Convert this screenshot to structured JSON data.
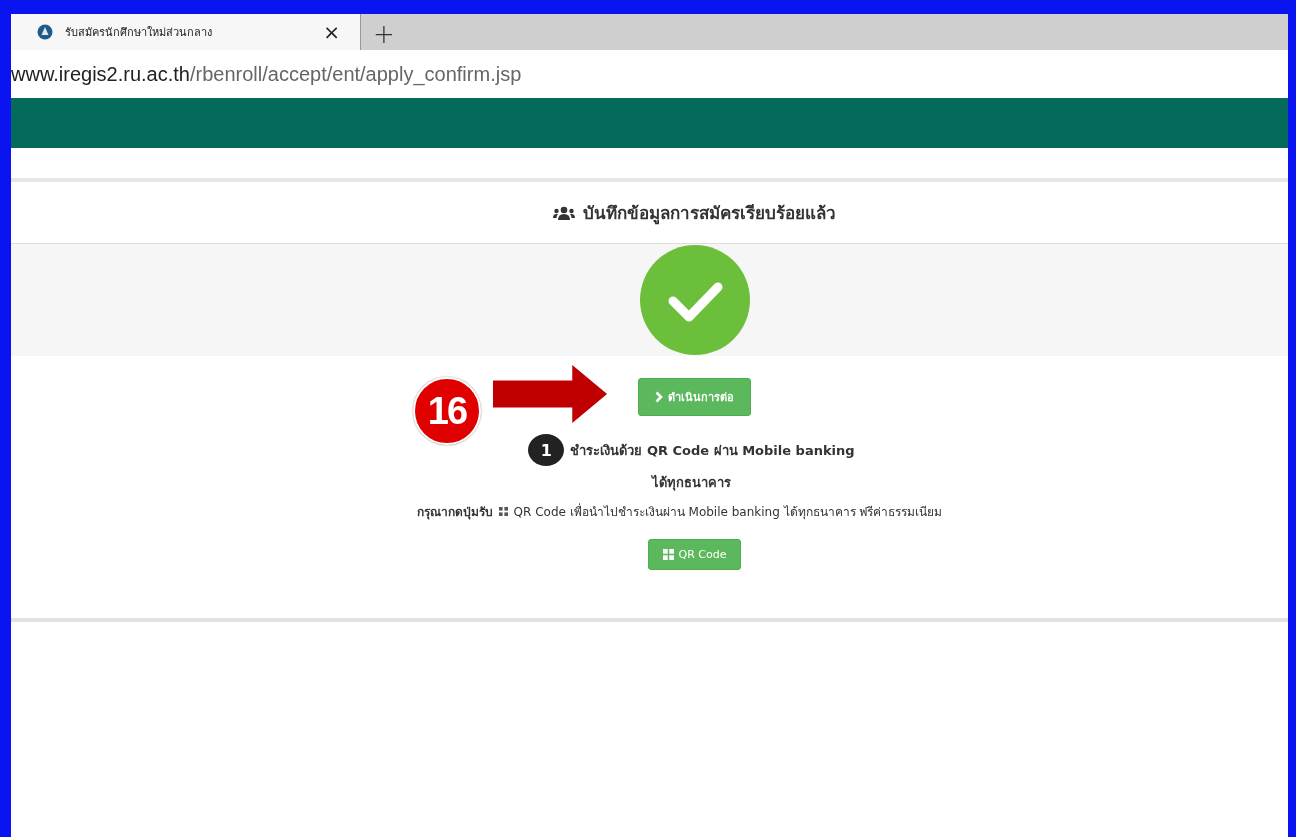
{
  "browser": {
    "tab": {
      "title": "รับสมัครนักศึกษาใหม่ส่วนกลาง",
      "close": "×",
      "selected": true
    },
    "new_tab": "+",
    "url_host": "www.iregis2.ru.ac.th",
    "url_path": "/rbenroll/accept/ent/apply_confirm.jsp"
  },
  "card": {
    "heading": "บันทึกข้อมูลการสมัครเรียบร้อยแล้ว",
    "continue_button": "ดำเนินการต่อ",
    "step": {
      "number": "1",
      "title": "ชำระเงินด้วย QR Code ผ่าน Mobile banking",
      "subtitle": "ได้ทุกธนาคาร"
    },
    "instruction_before": "กรุณากดปุ่มรับ",
    "instruction_after": "QR Code เพื่อนำไปชำระเงินผ่าน Mobile banking ได้ทุกธนาคาร ฟรีค่าธรรมเนียม",
    "qr_button": "QR Code"
  },
  "annotation": {
    "label": "16"
  }
}
